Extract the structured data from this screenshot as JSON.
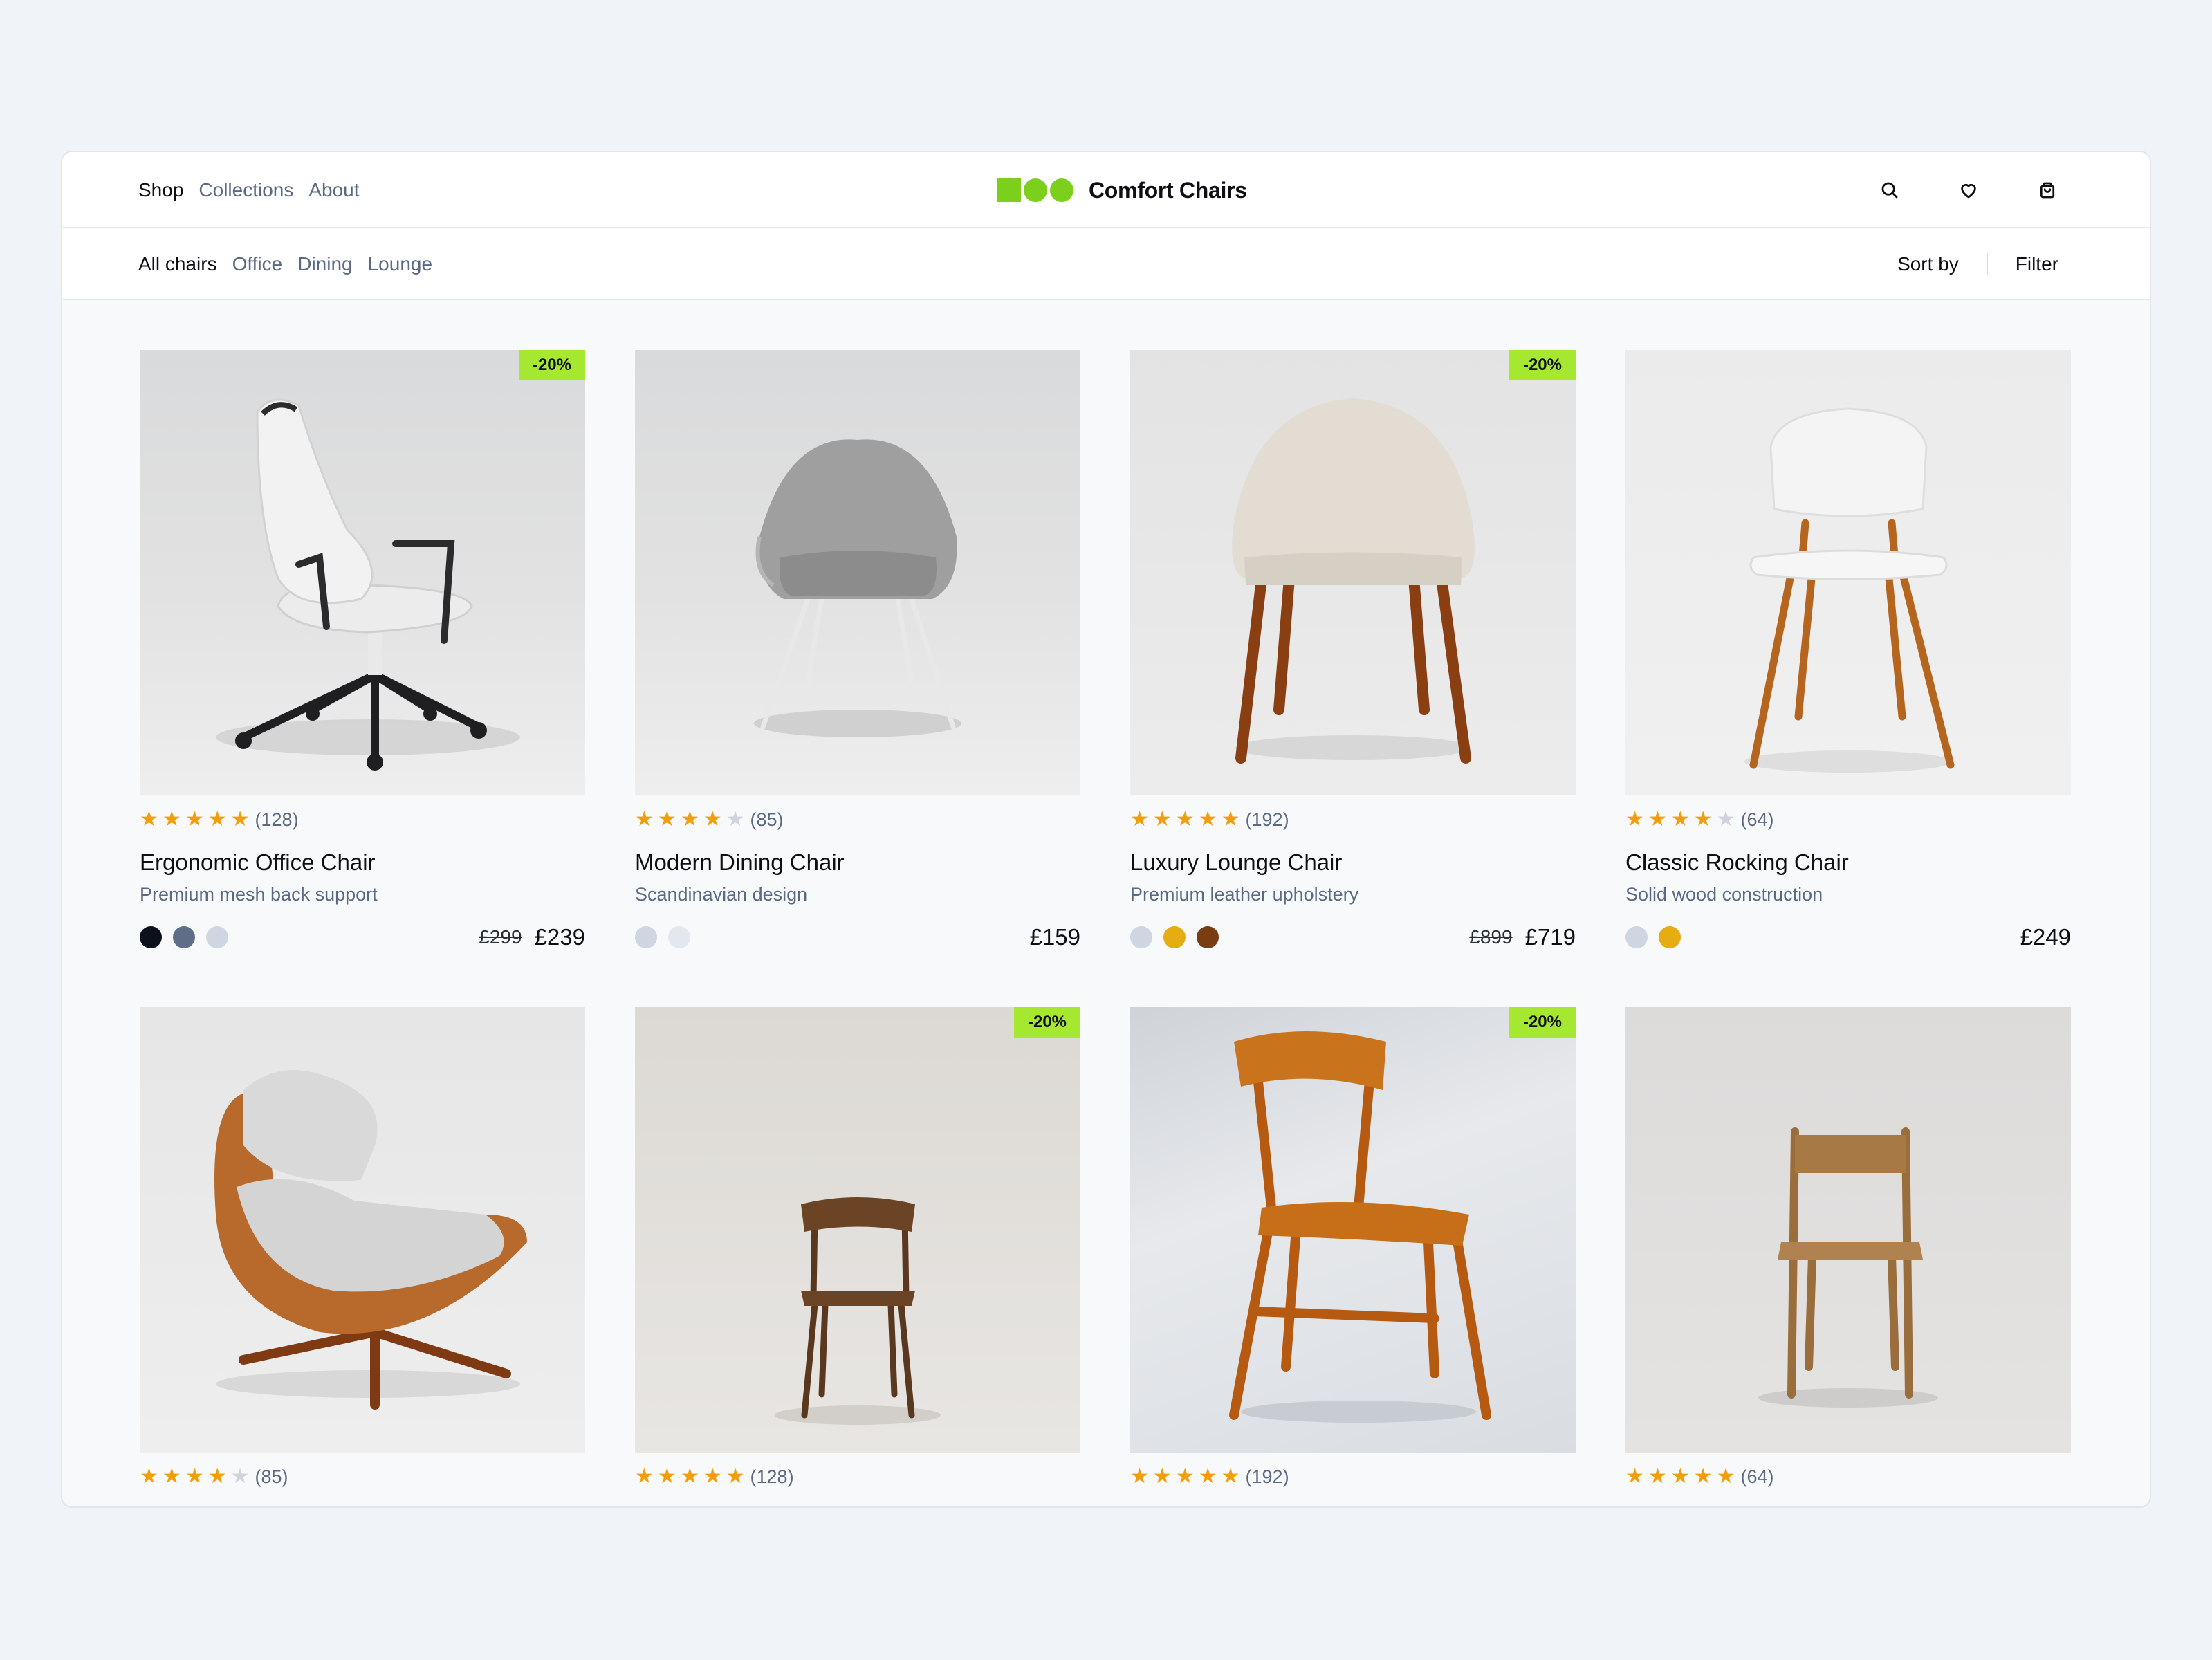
{
  "brand": {
    "name": "Comfort Chairs",
    "accent": "#7ccf1a"
  },
  "nav": [
    "Shop",
    "Collections",
    "About"
  ],
  "categories": [
    "All chairs",
    "Office",
    "Dining",
    "Lounge"
  ],
  "toolbar": {
    "sort_label": "Sort by",
    "filter_label": "Filter"
  },
  "header_icons": [
    "search-icon",
    "heart-icon",
    "shopping-bag-icon"
  ],
  "products": [
    {
      "name": "Ergonomic Office Chair",
      "desc": "Premium mesh back support",
      "rating": 5,
      "reviews": "(128)",
      "badge": "-20%",
      "old_price": "£299",
      "price": "£239",
      "colors": [
        "#0d111c",
        "#5f6e86",
        "#cfd6e1"
      ]
    },
    {
      "name": "Modern Dining Chair",
      "desc": "Scandinavian design",
      "rating": 4,
      "reviews": "(85)",
      "badge": "",
      "old_price": "",
      "price": "£159",
      "colors": [
        "#cfd6e1",
        "#e3e7ee"
      ]
    },
    {
      "name": "Luxury Lounge Chair",
      "desc": "Premium leather upholstery",
      "rating": 5,
      "reviews": "(192)",
      "badge": "-20%",
      "old_price": "£899",
      "price": "£719",
      "colors": [
        "#cfd6e1",
        "#e5ad12",
        "#7a3d12"
      ]
    },
    {
      "name": "Classic Rocking Chair",
      "desc": "Solid wood construction",
      "rating": 4,
      "reviews": "(64)",
      "badge": "",
      "old_price": "",
      "price": "£249",
      "colors": [
        "#cfd6e1",
        "#e5ad12"
      ]
    },
    {
      "name": "",
      "desc": "",
      "rating": 4,
      "reviews": "(85)",
      "badge": "",
      "old_price": "",
      "price": "",
      "colors": []
    },
    {
      "name": "",
      "desc": "",
      "rating": 5,
      "reviews": "(128)",
      "badge": "-20%",
      "old_price": "",
      "price": "",
      "colors": []
    },
    {
      "name": "",
      "desc": "",
      "rating": 5,
      "reviews": "(192)",
      "badge": "-20%",
      "old_price": "",
      "price": "",
      "colors": []
    },
    {
      "name": "",
      "desc": "",
      "rating": 5,
      "reviews": "(64)",
      "badge": "",
      "old_price": "",
      "price": "",
      "colors": []
    }
  ]
}
